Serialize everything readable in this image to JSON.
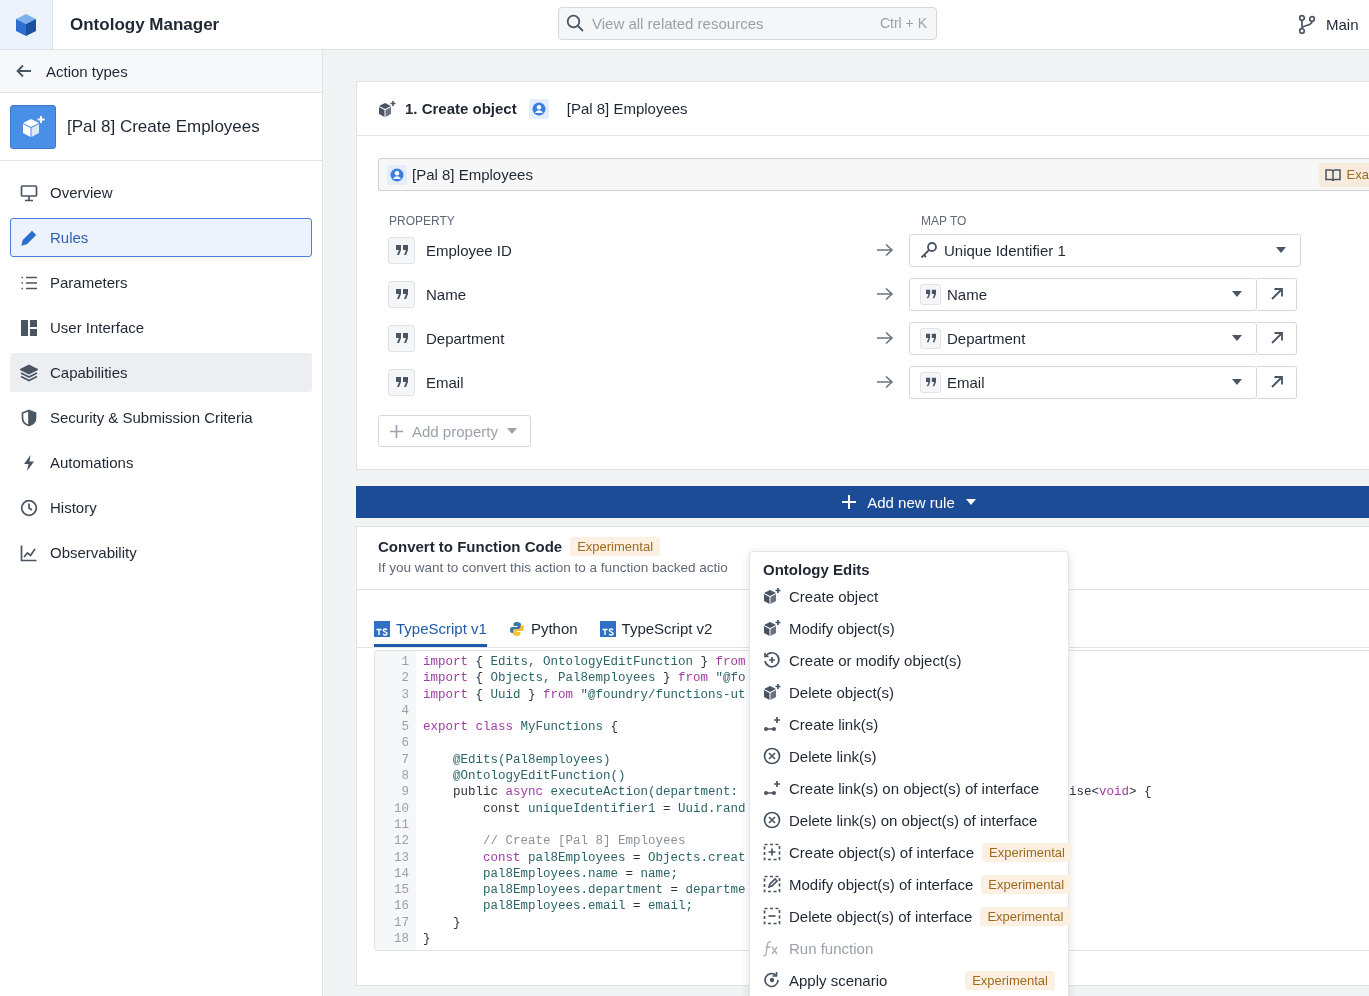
{
  "app": {
    "title": "Ontology Manager",
    "search": {
      "placeholder": "View all related resources",
      "shortcut": "Ctrl + K"
    },
    "branch": "Main"
  },
  "sidebar": {
    "back": "Action types",
    "action_title": "[Pal 8] Create Employees",
    "items": [
      {
        "label": "Overview",
        "selected": false,
        "hovered": false
      },
      {
        "label": "Rules",
        "selected": true,
        "hovered": false
      },
      {
        "label": "Parameters",
        "selected": false,
        "hovered": false
      },
      {
        "label": "User Interface",
        "selected": false,
        "hovered": false
      },
      {
        "label": "Capabilities",
        "selected": false,
        "hovered": true
      },
      {
        "label": "Security & Submission Criteria",
        "selected": false,
        "hovered": false
      },
      {
        "label": "Automations",
        "selected": false,
        "hovered": false
      },
      {
        "label": "History",
        "selected": false,
        "hovered": false
      },
      {
        "label": "Observability",
        "selected": false,
        "hovered": false
      }
    ]
  },
  "rule": {
    "title": "1. Create object",
    "object": "[Pal 8] Employees",
    "object_field": "[Pal 8] Employees",
    "examples_button": "Exa",
    "columns": [
      "PROPERTY",
      "MAP TO"
    ],
    "rows": [
      {
        "property": "Employee ID",
        "target": "Unique Identifier 1",
        "kind": "identifier"
      },
      {
        "property": "Name",
        "target": "Name",
        "kind": "property"
      },
      {
        "property": "Department",
        "target": "Department",
        "kind": "property"
      },
      {
        "property": "Email",
        "target": "Email",
        "kind": "property"
      }
    ],
    "add_property": "Add property"
  },
  "add_rule_button": "Add new rule",
  "convert": {
    "title": "Convert to Function Code",
    "badge": "Experimental",
    "description": "If you want to convert this action to a function backed actio",
    "tabs": [
      {
        "label": "TypeScript v1",
        "selected": true,
        "kind": "ts"
      },
      {
        "label": "Python",
        "selected": false,
        "kind": "python"
      },
      {
        "label": "TypeScript v2",
        "selected": false,
        "kind": "ts"
      }
    ],
    "code": [
      {
        "number": "1",
        "tokens": [
          {
            "kind": "kw",
            "text": "import"
          },
          {
            "kind": "pl",
            "text": " { "
          },
          {
            "kind": "id",
            "text": "Edits, OntologyEditFunction"
          },
          {
            "kind": "pl",
            "text": " } "
          },
          {
            "kind": "kw",
            "text": "from"
          }
        ]
      },
      {
        "number": "2",
        "tokens": [
          {
            "kind": "kw",
            "text": "import"
          },
          {
            "kind": "pl",
            "text": " { "
          },
          {
            "kind": "id",
            "text": "Objects, Pal8employees"
          },
          {
            "kind": "pl",
            "text": " } "
          },
          {
            "kind": "kw",
            "text": "from"
          },
          {
            "kind": "id",
            "text": " \"@fo"
          }
        ]
      },
      {
        "number": "3",
        "tokens": [
          {
            "kind": "kw",
            "text": "import"
          },
          {
            "kind": "pl",
            "text": " { "
          },
          {
            "kind": "id",
            "text": "Uuid"
          },
          {
            "kind": "pl",
            "text": " } "
          },
          {
            "kind": "kw",
            "text": "from"
          },
          {
            "kind": "id",
            "text": " \"@foundry/functions-ut"
          }
        ]
      },
      {
        "number": "4"
      },
      {
        "number": "5",
        "tokens": [
          {
            "kind": "kw",
            "text": "export class"
          },
          {
            "kind": "id",
            "text": " MyFunctions"
          },
          {
            "kind": "pl",
            "text": " {"
          }
        ]
      },
      {
        "number": "6"
      },
      {
        "number": "7",
        "tokens": [
          {
            "kind": "id",
            "text": "    @Edits(Pal8employees)"
          }
        ]
      },
      {
        "number": "8",
        "tokens": [
          {
            "kind": "id",
            "text": "    @OntologyEditFunction()"
          }
        ]
      },
      {
        "number": "9",
        "tokens": [
          {
            "kind": "pl",
            "text": "    public "
          },
          {
            "kind": "kw",
            "text": "async"
          },
          {
            "kind": "id",
            "text": " executeAction(department:"
          }
        ],
        "tail": [
          {
            "kind": "pl",
            "text": "ise<"
          },
          {
            "kind": "kw",
            "text": "void"
          },
          {
            "kind": "pl",
            "text": "> {"
          }
        ]
      },
      {
        "number": "10",
        "tokens": [
          {
            "kind": "pl",
            "text": "        const "
          },
          {
            "kind": "id",
            "text": "uniqueIdentifier1"
          },
          {
            "kind": "pl",
            "text": " = "
          },
          {
            "kind": "id",
            "text": "Uuid.rand"
          }
        ]
      },
      {
        "number": "11"
      },
      {
        "number": "12",
        "tokens": [
          {
            "kind": "cm",
            "text": "        // Create [Pal 8] Employees"
          }
        ]
      },
      {
        "number": "13",
        "tokens": [
          {
            "kind": "kw",
            "text": "        const"
          },
          {
            "kind": "id",
            "text": " pal8Employees"
          },
          {
            "kind": "pl",
            "text": " = "
          },
          {
            "kind": "id",
            "text": "Objects.creat"
          }
        ]
      },
      {
        "number": "14",
        "tokens": [
          {
            "kind": "id",
            "text": "        pal8Employees.name"
          },
          {
            "kind": "pl",
            "text": " = "
          },
          {
            "kind": "id",
            "text": "name;"
          }
        ]
      },
      {
        "number": "15",
        "tokens": [
          {
            "kind": "id",
            "text": "        pal8Employees.department"
          },
          {
            "kind": "pl",
            "text": " = "
          },
          {
            "kind": "id",
            "text": "departme"
          }
        ]
      },
      {
        "number": "16",
        "tokens": [
          {
            "kind": "id",
            "text": "        pal8Employees.email"
          },
          {
            "kind": "pl",
            "text": " = "
          },
          {
            "kind": "id",
            "text": "email;"
          }
        ]
      },
      {
        "number": "17",
        "tokens": [
          {
            "kind": "pl",
            "text": "    }"
          }
        ]
      },
      {
        "number": "18",
        "tokens": [
          {
            "kind": "pl",
            "text": "}"
          }
        ]
      }
    ]
  },
  "menu": {
    "heading": "Ontology Edits",
    "items": [
      {
        "label": "Create object",
        "disabled": false
      },
      {
        "label": "Modify object(s)",
        "disabled": false
      },
      {
        "label": "Create or modify object(s)",
        "disabled": false
      },
      {
        "label": "Delete object(s)",
        "disabled": false
      },
      {
        "label": "Create link(s)",
        "disabled": false
      },
      {
        "label": "Delete link(s)",
        "disabled": false
      },
      {
        "label": "Create link(s) on object(s) of interface",
        "disabled": false
      },
      {
        "label": "Delete link(s) on object(s) of interface",
        "disabled": false
      },
      {
        "label": "Create object(s) of interface",
        "disabled": false,
        "badge": "Experimental"
      },
      {
        "label": "Modify object(s) of interface",
        "disabled": false,
        "badge": "Experimental"
      },
      {
        "label": "Delete object(s) of interface",
        "disabled": false,
        "badge": "Experimental"
      },
      {
        "label": "Run function",
        "disabled": true
      },
      {
        "label": "Apply scenario",
        "disabled": false,
        "badge": "Experimental"
      }
    ]
  }
}
